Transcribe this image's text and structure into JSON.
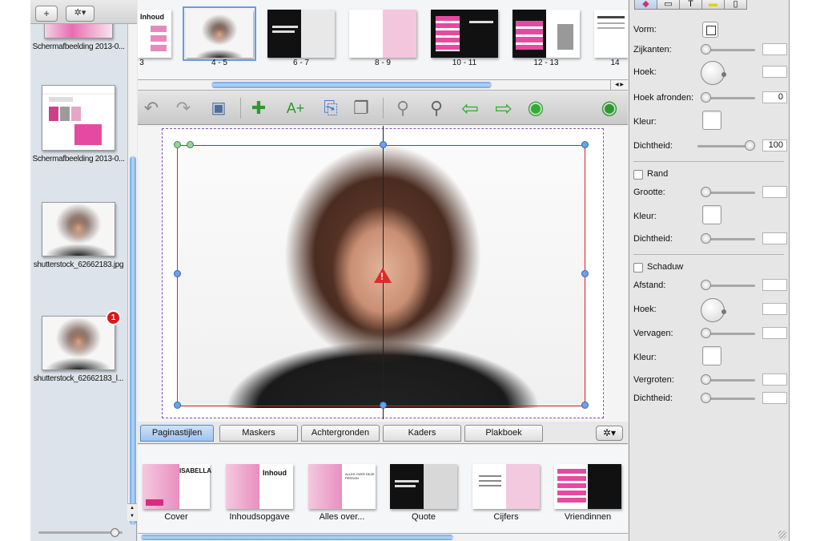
{
  "sidebar": {
    "add_label": "+",
    "gear_label": "✲▾",
    "items": [
      {
        "label": "Schermafbeelding 2013-0...",
        "kind": "screenshot-pink"
      },
      {
        "label": "Schermafbeelding 2013-0...",
        "kind": "screenshot-web"
      },
      {
        "label": "shutterstock_62662183.jpg",
        "kind": "photo"
      },
      {
        "label": "shutterstock_62662183_l...",
        "kind": "photo",
        "badge": "1"
      }
    ]
  },
  "pages": [
    {
      "num": "3",
      "title": "Inhoud",
      "kind": "toc"
    },
    {
      "num": "4 - 5",
      "kind": "photo",
      "selected": true
    },
    {
      "num": "6 - 7",
      "kind": "dark"
    },
    {
      "num": "8 - 9",
      "kind": "pink"
    },
    {
      "num": "10 - 11",
      "kind": "black-pink"
    },
    {
      "num": "12 - 13",
      "kind": "black-boot"
    },
    {
      "num": "14",
      "kind": "text"
    }
  ],
  "toolbar": {
    "icons": [
      "undo-icon",
      "redo-icon",
      "save-icon",
      "add-photo-icon",
      "add-text-icon",
      "insert-page-icon",
      "duplicate-page-icon",
      "zoom-out-icon",
      "zoom-in-icon",
      "previous-page-icon",
      "next-page-icon",
      "play-icon",
      "shopping-cart-icon"
    ]
  },
  "tabs": {
    "items": [
      "Paginastijlen",
      "Maskers",
      "Achtergronden",
      "Kaders",
      "Plakboek"
    ],
    "active_index": 0,
    "gear_label": "✲▾"
  },
  "styles": [
    {
      "label": "Cover",
      "title": "ISABELLA"
    },
    {
      "label": "Inhoudsopgave",
      "title": "Inhoud"
    },
    {
      "label": "Alles over...",
      "title": "ALLES OVER DEZE PERSON"
    },
    {
      "label": "Quote",
      "title": ""
    },
    {
      "label": "Cijfers",
      "title": ""
    },
    {
      "label": "Vriendinnen",
      "title": ""
    }
  ],
  "inspector": {
    "tabs": [
      "color-icon",
      "frame-icon",
      "text-icon",
      "highlight-icon",
      "page-icon"
    ],
    "vorm_label": "Vorm:",
    "zijkanten_label": "Zijkanten:",
    "hoek_label": "Hoek:",
    "hoek_afronden_label": "Hoek afronden:",
    "hoek_afronden_value": "0",
    "kleur_label": "Kleur:",
    "dichtheid_label": "Dichtheid:",
    "dichtheid_value": "100",
    "rand_label": "Rand",
    "grootte_label": "Grootte:",
    "rand_kleur_label": "Kleur:",
    "rand_dichtheid_label": "Dichtheid:",
    "schaduw_label": "Schaduw",
    "afstand_label": "Afstand:",
    "schaduw_hoek_label": "Hoek:",
    "vervagen_label": "Vervagen:",
    "schaduw_kleur_label": "Kleur:",
    "vergroten_label": "Vergroten:",
    "schaduw_dichtheid_label": "Dichtheid:"
  },
  "colors": {
    "accent": "#6a9be0",
    "selection_frame": "#e02020",
    "pink": "#e64aa0"
  }
}
